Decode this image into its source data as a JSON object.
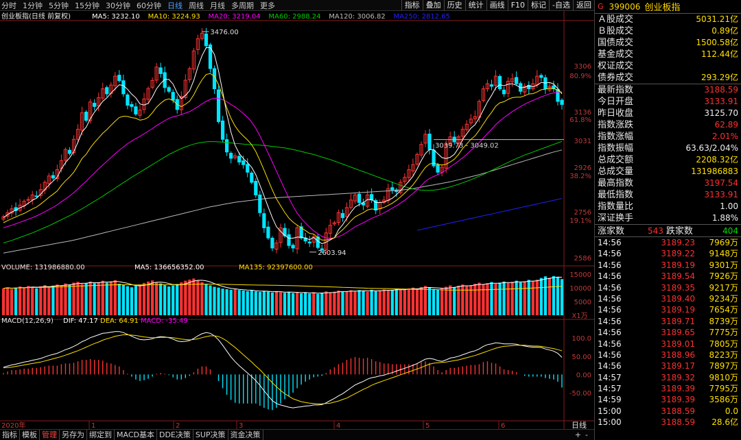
{
  "toolbar": {
    "periods": [
      "分时",
      "1分钟",
      "5分钟",
      "15分钟",
      "30分钟",
      "60分钟",
      "日线",
      "周线",
      "月线",
      "多周期",
      "更多"
    ],
    "active_period": "日线",
    "right_buttons": [
      "指标",
      "叠加",
      "历史",
      "统计",
      "画线",
      "F10",
      "标记",
      "-自选",
      "返回"
    ]
  },
  "main_legend": {
    "title": "创业板指(日线 前复权)",
    "ma5": "MA5: 3232.10",
    "ma10": "MA10: 3224.93",
    "ma20": "MA20: 3219.04",
    "ma60": "MA60: 2988.24",
    "ma120": "MA120: 3006.82",
    "ma250": "MA250: 2812.65"
  },
  "annotations": {
    "high": "3476.00",
    "low": "2603.94",
    "range": "3039.73 - 3049.02"
  },
  "main_axis": {
    "labels": [
      "3306",
      "80.9%",
      "3136",
      "61.8%",
      "3031",
      "2926",
      "38.2%",
      "2756",
      "19.1%",
      "2586"
    ]
  },
  "volume_legend": {
    "volume": "VOLUME: 131986880.00",
    "ma5": "MA5: 136656352.00",
    "ma135": "MA135: 92397600.00"
  },
  "volume_axis": {
    "labels": [
      "15000",
      "10000",
      "5000"
    ],
    "unit": "X1万"
  },
  "macd_legend": {
    "title": "MACD(12,26,9)",
    "dif": "DIF: 47.17",
    "dea": "DEA: 64.91",
    "macd": "MACD: -35.49"
  },
  "macd_axis": {
    "labels": [
      "100.0",
      "50.00",
      "0.00",
      "-50.00"
    ]
  },
  "x_axis": {
    "labels": [
      "2020年",
      "1",
      "2",
      "3",
      "4",
      "5",
      "6"
    ],
    "period_label": "日线"
  },
  "chart_data": {
    "type": "candlestick",
    "instrument": "创业板指",
    "price_range": [
      2560,
      3520
    ],
    "high": 3476.0,
    "low": 2603.94,
    "closes": [
      2744,
      2760,
      2775,
      2768,
      2790,
      2805,
      2812,
      2830,
      2825,
      2851,
      2880,
      2905,
      2897,
      2930,
      2966,
      3010,
      2994,
      3050,
      3090,
      3155,
      3125,
      3198,
      3180,
      3215,
      3250,
      3230,
      3265,
      3300,
      3282,
      3230,
      3185,
      3180,
      3150,
      3166,
      3210,
      3251,
      3283,
      3336,
      3310,
      3255,
      3240,
      3205,
      3168,
      3220,
      3284,
      3330,
      3400,
      3448,
      3470,
      3420,
      3330,
      3250,
      3120,
      3050,
      3000,
      2975,
      2985,
      2960,
      2950,
      2920,
      2880,
      2830,
      2760,
      2700,
      2660,
      2620,
      2640,
      2700,
      2668,
      2630,
      2620,
      2700,
      2660,
      2648,
      2640,
      2665,
      2622,
      2612,
      2680,
      2710,
      2720,
      2760,
      2740,
      2780,
      2810,
      2830,
      2800,
      2790,
      2830,
      2810,
      2770,
      2800,
      2810,
      2855,
      2850,
      2843,
      2880,
      2900,
      2930,
      2950,
      2990,
      3030,
      3070,
      3010,
      2945,
      2920,
      2940,
      3030,
      3060,
      3040,
      3060,
      3090,
      3110,
      3130,
      3140,
      3200,
      3250,
      3270,
      3260,
      3300,
      3250,
      3230,
      3280,
      3290,
      3270,
      3240,
      3260,
      3250,
      3270,
      3300,
      3295,
      3250,
      3260,
      3250,
      3200,
      3188
    ],
    "ma5": [
      2740,
      2752,
      2762,
      2770,
      2779,
      2786,
      2797,
      2809,
      2817,
      2833,
      2851,
      2869,
      2885,
      2900,
      2933,
      2958,
      2977,
      3001,
      3038,
      3079,
      3098,
      3131,
      3158,
      3178,
      3200,
      3214,
      3233,
      3250,
      3266,
      3263,
      3248,
      3229,
      3214,
      3190,
      3186,
      3192,
      3218,
      3250,
      3271,
      3287,
      3287,
      3269,
      3233,
      3211,
      3224,
      3242,
      3283,
      3337,
      3381,
      3413,
      3413,
      3386,
      3321,
      3238,
      3150,
      3079,
      3026,
      2994,
      2974,
      2958,
      2939,
      2910,
      2869,
      2826,
      2782,
      2740,
      2704,
      2686,
      2670,
      2659,
      2659,
      2663,
      2663,
      2659,
      2653,
      2662,
      2647,
      2637,
      2643,
      2652,
      2661,
      2692,
      2712,
      2737,
      2762,
      2782,
      2792,
      2800,
      2812,
      2812,
      2800,
      2800,
      2802,
      2809,
      2817,
      2831,
      2847,
      2866,
      2884,
      2904,
      2934,
      2966,
      2994,
      3010,
      3009,
      2993,
      2978,
      2974,
      2979,
      2991,
      3016,
      3050,
      3072,
      3094,
      3108,
      3134,
      3166,
      3198,
      3224,
      3254,
      3266,
      3262,
      3268,
      3270,
      3264,
      3254,
      3256,
      3262,
      3258,
      3264,
      3275,
      3273,
      3275,
      3269,
      3251,
      3230
    ],
    "ma20": [
      2700,
      2705,
      2710,
      2716,
      2722,
      2728,
      2734,
      2740,
      2747,
      2755,
      2763,
      2772,
      2781,
      2791,
      2803,
      2814,
      2826,
      2839,
      2854,
      2870,
      2884,
      2901,
      2917,
      2933,
      2948,
      2963,
      2978,
      2993,
      3007,
      3020,
      3033,
      3043,
      3053,
      3062,
      3072,
      3082,
      3093,
      3104,
      3114,
      3124,
      3133,
      3139,
      3143,
      3148,
      3154,
      3160,
      3169,
      3179,
      3190,
      3200,
      3208,
      3213,
      3212,
      3207,
      3199,
      3188,
      3178,
      3166,
      3152,
      3137,
      3118,
      3094,
      3064,
      3030,
      2995,
      2960,
      2924,
      2888,
      2852,
      2818,
      2786,
      2758,
      2737,
      2719,
      2703,
      2688,
      2676,
      2666,
      2660,
      2659,
      2660,
      2665,
      2672,
      2682,
      2693,
      2704,
      2712,
      2720,
      2729,
      2737,
      2744,
      2751,
      2759,
      2768,
      2778,
      2787,
      2798,
      2809,
      2822,
      2836,
      2851,
      2867,
      2884,
      2895,
      2903,
      2910,
      2918,
      2929,
      2941,
      2952,
      2964,
      2977,
      2991,
      3006,
      3020,
      3037,
      3055,
      3073,
      3090,
      3108,
      3123,
      3136,
      3148,
      3160,
      3170,
      3180,
      3189,
      3197,
      3204,
      3211,
      3218,
      3224,
      3230,
      3234,
      3237,
      3238
    ],
    "ma60": [
      2640,
      2645,
      2650,
      2656,
      2662,
      2668,
      2674,
      2680,
      2687,
      2694,
      2701,
      2708,
      2716,
      2724,
      2732,
      2740,
      2748,
      2757,
      2766,
      2775,
      2785,
      2795,
      2805,
      2815,
      2825,
      2836,
      2846,
      2857,
      2868,
      2879,
      2889,
      2900,
      2910,
      2920,
      2930,
      2940,
      2950,
      2960,
      2970,
      2980,
      2990,
      2998,
      3006,
      3014,
      3020,
      3026,
      3031,
      3035,
      3038,
      3040,
      3041,
      3041,
      3040,
      3039,
      3037,
      3036,
      3034,
      3033,
      3031,
      3030,
      3029,
      3028,
      3027,
      3026,
      3024,
      3022,
      3020,
      3018,
      3016,
      3013,
      3010,
      3006,
      3002,
      2998,
      2994,
      2990,
      2985,
      2980,
      2975,
      2970,
      2964,
      2958,
      2952,
      2946,
      2940,
      2934,
      2928,
      2922,
      2916,
      2910,
      2904,
      2898,
      2892,
      2886,
      2880,
      2874,
      2868,
      2863,
      2858,
      2854,
      2851,
      2849,
      2848,
      2848,
      2849,
      2851,
      2854,
      2858,
      2862,
      2867,
      2872,
      2878,
      2884,
      2890,
      2897,
      2904,
      2911,
      2919,
      2927,
      2935,
      2943,
      2951,
      2959,
      2967,
      2974,
      2981,
      2988,
      2994,
      3000,
      3006,
      3012,
      3018,
      3024,
      3030,
      3036,
      3042
    ],
    "ma120": [
      2600,
      2603,
      2606,
      2609,
      2612,
      2615,
      2618,
      2621,
      2624,
      2627,
      2630,
      2633,
      2636,
      2639,
      2642,
      2645,
      2648,
      2651,
      2655,
      2659,
      2663,
      2667,
      2671,
      2675,
      2679,
      2683,
      2687,
      2691,
      2695,
      2699,
      2703,
      2707,
      2711,
      2715,
      2719,
      2723,
      2727,
      2731,
      2735,
      2739,
      2743,
      2747,
      2751,
      2755,
      2759,
      2763,
      2767,
      2771,
      2775,
      2779,
      2783,
      2786,
      2789,
      2792,
      2795,
      2798,
      2801,
      2803,
      2805,
      2807,
      2809,
      2811,
      2813,
      2815,
      2817,
      2818,
      2819,
      2820,
      2821,
      2822,
      2823,
      2824,
      2825,
      2826,
      2827,
      2828,
      2829,
      2830,
      2831,
      2832,
      2833,
      2834,
      2835,
      2836,
      2837,
      2838,
      2839,
      2840,
      2841,
      2842,
      2843,
      2844,
      2845,
      2846,
      2847,
      2848,
      2849,
      2851,
      2853,
      2855,
      2858,
      2861,
      2864,
      2867,
      2870,
      2873,
      2876,
      2879,
      2882,
      2886,
      2890,
      2894,
      2898,
      2902,
      2906,
      2910,
      2915,
      2920,
      2925,
      2930,
      2935,
      2940,
      2945,
      2950,
      2955,
      2960,
      2965,
      2970,
      2975,
      2980,
      2985,
      2990,
      2995,
      3000,
      3004,
      3008
    ],
    "volume_wan": [
      9800,
      10200,
      9600,
      10100,
      10500,
      9900,
      10700,
      10300,
      9800,
      10600,
      11000,
      10400,
      10800,
      11200,
      10900,
      11600,
      11100,
      11900,
      12200,
      11400,
      11800,
      12300,
      11700,
      12100,
      12600,
      11900,
      12400,
      12800,
      11500,
      11000,
      10600,
      10200,
      10700,
      11200,
      11800,
      12300,
      12700,
      12100,
      11600,
      11000,
      10500,
      10900,
      11400,
      12000,
      12600,
      13000,
      13400,
      12800,
      12100,
      11500,
      10900,
      10400,
      10100,
      9700,
      9500,
      9300,
      9600,
      9200,
      9000,
      8800,
      9100,
      8700,
      8500,
      8900,
      8600,
      8300,
      8800,
      8400,
      8200,
      8600,
      8100,
      8500,
      8000,
      8300,
      7900,
      8400,
      7800,
      8200,
      8700,
      8300,
      8600,
      9000,
      8500,
      8800,
      9100,
      8700,
      9200,
      8900,
      8600,
      9300,
      8800,
      9100,
      9400,
      9000,
      9300,
      9700,
      9200,
      9500,
      9800,
      10100,
      9600,
      10300,
      10700,
      10000,
      9600,
      9300,
      9800,
      10400,
      10900,
      10300,
      10800,
      11200,
      10600,
      11000,
      11500,
      11900,
      11300,
      11700,
      12100,
      11500,
      11900,
      12300,
      11800,
      12200,
      12600,
      12000,
      12400,
      12900,
      12500,
      13000,
      13600,
      14200,
      13700,
      14300,
      13900,
      13200
    ],
    "volume_ma5_wan": 13665.6352,
    "volume_ma135_wan": 9239.76,
    "macd": {
      "dif_last": 47.17,
      "dea_last": 64.91,
      "macd_last": -35.49,
      "dif": [
        20,
        23,
        26,
        28,
        31,
        34,
        36,
        39,
        41,
        44,
        48,
        52,
        55,
        58,
        63,
        68,
        72,
        77,
        83,
        90,
        95,
        101,
        105,
        109,
        113,
        114,
        116,
        118,
        118,
        115,
        110,
        105,
        100,
        96,
        95,
        96,
        98,
        102,
        104,
        103,
        101,
        97,
        92,
        90,
        91,
        93,
        99,
        106,
        112,
        115,
        113,
        106,
        95,
        80,
        64,
        48,
        35,
        24,
        14,
        4,
        -6,
        -17,
        -30,
        -45,
        -59,
        -72,
        -80,
        -84,
        -87,
        -90,
        -92,
        -90,
        -89,
        -87,
        -86,
        -84,
        -84,
        -83,
        -78,
        -72,
        -66,
        -59,
        -53,
        -45,
        -37,
        -29,
        -24,
        -19,
        -13,
        -9,
        -7,
        -4,
        -2,
        2,
        5,
        9,
        13,
        17,
        21,
        25,
        30,
        36,
        42,
        44,
        42,
        38,
        36,
        40,
        45,
        47,
        50,
        54,
        58,
        62,
        65,
        70,
        77,
        82,
        84,
        87,
        86,
        84,
        84,
        84,
        83,
        80,
        78,
        76,
        75,
        75,
        74,
        70,
        67,
        64,
        58,
        47
      ],
      "dea": [
        18,
        19,
        20,
        22,
        24,
        26,
        28,
        30,
        32,
        34,
        37,
        40,
        43,
        46,
        49,
        53,
        57,
        61,
        65,
        70,
        75,
        80,
        85,
        89,
        94,
        98,
        101,
        105,
        107,
        109,
        109,
        108,
        107,
        105,
        103,
        102,
        101,
        101,
        102,
        102,
        102,
        101,
        99,
        97,
        96,
        95,
        96,
        98,
        101,
        104,
        106,
        106,
        104,
        99,
        92,
        83,
        74,
        64,
        54,
        44,
        34,
        23,
        13,
        1,
        -11,
        -23,
        -34,
        -44,
        -53,
        -60,
        -67,
        -71,
        -75,
        -77,
        -79,
        -80,
        -81,
        -81,
        -80,
        -79,
        -76,
        -73,
        -69,
        -65,
        -59,
        -53,
        -47,
        -41,
        -36,
        -30,
        -25,
        -21,
        -17,
        -13,
        -9,
        -5,
        -1,
        3,
        7,
        11,
        15,
        19,
        24,
        28,
        31,
        32,
        33,
        34,
        36,
        38,
        40,
        43,
        46,
        49,
        52,
        56,
        60,
        64,
        68,
        72,
        75,
        77,
        78,
        79,
        80,
        80,
        80,
        79,
        78,
        78,
        77,
        75,
        73,
        71,
        68,
        65
      ]
    }
  },
  "panel": {
    "flag": "G",
    "code": "399006",
    "name": "创业板指",
    "turnover": [
      {
        "k": "Ａ股成交",
        "v": "5031.21亿",
        "c": "yel"
      },
      {
        "k": "Ｂ股成交",
        "v": "0.89亿",
        "c": "yel"
      },
      {
        "k": "国债成交",
        "v": "1500.58亿",
        "c": "yel"
      },
      {
        "k": "基金成交",
        "v": "112.44亿",
        "c": "yel"
      },
      {
        "k": "权证成交",
        "v": "",
        "c": "yel"
      },
      {
        "k": "债券成交",
        "v": "293.29亿",
        "c": "yel"
      }
    ],
    "quote": [
      {
        "k": "最新指数",
        "v": "3188.59",
        "c": "red"
      },
      {
        "k": "今日开盘",
        "v": "3133.91",
        "c": "red"
      },
      {
        "k": "昨日收盘",
        "v": "3125.70",
        "c": "wht"
      },
      {
        "k": "指数涨跌",
        "v": "62.89",
        "c": "red"
      },
      {
        "k": "指数涨幅",
        "v": "2.01%",
        "c": "red"
      },
      {
        "k": "指数振幅",
        "v": "63.63/2.04%",
        "c": "wht"
      },
      {
        "k": "总成交额",
        "v": "2208.32亿",
        "c": "yel"
      },
      {
        "k": "总成交量",
        "v": "131986883",
        "c": "yel"
      },
      {
        "k": "最高指数",
        "v": "3197.54",
        "c": "red"
      },
      {
        "k": "最低指数",
        "v": "3133.91",
        "c": "red"
      },
      {
        "k": "指数量比",
        "v": "1.00",
        "c": "wht"
      },
      {
        "k": "深证换手",
        "v": "1.88%",
        "c": "wht"
      }
    ],
    "updown": {
      "up_label": "涨家数",
      "up": "543",
      "down_label": "跌家数",
      "down": "404"
    },
    "ticks": [
      {
        "t": "14:56",
        "p": "3189.23",
        "v": "7969万"
      },
      {
        "t": "14:56",
        "p": "3189.22",
        "v": "9148万"
      },
      {
        "t": "14:56",
        "p": "3189.19",
        "v": "9301万"
      },
      {
        "t": "14:56",
        "p": "3189.54",
        "v": "7926万"
      },
      {
        "t": "14:56",
        "p": "3189.35",
        "v": "9217万"
      },
      {
        "t": "14:56",
        "p": "3189.40",
        "v": "9234万"
      },
      {
        "t": "14:56",
        "p": "3189.19",
        "v": "7654万"
      },
      {
        "t": "14:56",
        "p": "3189.71",
        "v": "8739万"
      },
      {
        "t": "14:56",
        "p": "3189.65",
        "v": "7775万"
      },
      {
        "t": "14:56",
        "p": "3189.01",
        "v": "7805万"
      },
      {
        "t": "14:56",
        "p": "3188.96",
        "v": "8223万"
      },
      {
        "t": "14:56",
        "p": "3189.17",
        "v": "7897万"
      },
      {
        "t": "14:57",
        "p": "3189.32",
        "v": "9810万"
      },
      {
        "t": "14:57",
        "p": "3189.39",
        "v": "7795万"
      },
      {
        "t": "14:59",
        "p": "3189.39",
        "v": "3586万"
      },
      {
        "t": "15:00",
        "p": "3188.59",
        "v": "0.0"
      },
      {
        "t": "15:00",
        "p": "3188.59",
        "v": "28.6亿"
      }
    ]
  },
  "bottombar": {
    "items": [
      "指标",
      "模板",
      "管理",
      "另存为",
      "绑定到",
      "MACD基本",
      "DDE决策",
      "SUP决策",
      "资金决策"
    ],
    "active": "管理",
    "right_items": [
      "+",
      "-"
    ]
  },
  "colors": {
    "up": "#ff3232",
    "down": "#00e5ff",
    "ma5": "#ffffff",
    "ma10": "#ffe000",
    "ma20": "#ff00ff",
    "ma60": "#00cc00",
    "ma120": "#bbbbbb",
    "ma250": "#2020ff"
  }
}
